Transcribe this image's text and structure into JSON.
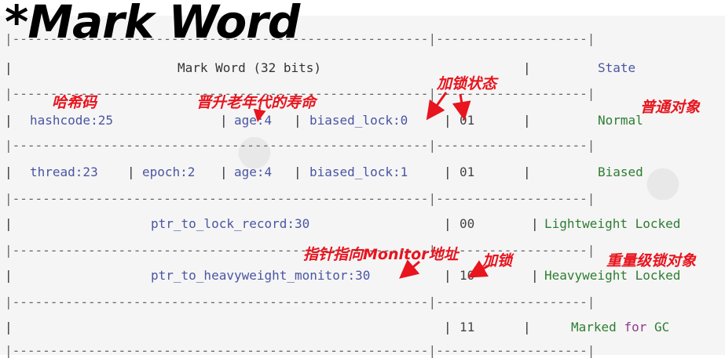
{
  "title": "*Mark Word",
  "table": {
    "header": {
      "left": "Mark Word (32 bits)",
      "right": "State"
    },
    "rows": [
      {
        "name": "normal",
        "cells": [
          "hashcode:25",
          "age:4",
          "biased_lock:0",
          "01"
        ],
        "state": "Normal"
      },
      {
        "name": "biased",
        "cells": [
          "thread:23",
          "epoch:2",
          "age:4",
          "biased_lock:1",
          "01"
        ],
        "state": "Biased"
      },
      {
        "name": "lightweight",
        "cells": [
          "ptr_to_lock_record:30",
          "00"
        ],
        "state": "Lightweight Locked"
      },
      {
        "name": "heavyweight",
        "cells": [
          "ptr_to_heavyweight_monitor:30",
          "10"
        ],
        "state": "Heavyweight Locked"
      },
      {
        "name": "gc",
        "cells": [
          "11"
        ],
        "state_parts": [
          "Marked",
          "for",
          "GC"
        ]
      }
    ]
  },
  "annotations": {
    "hashcode": "哈希码",
    "age": "晋升老年代的寿命",
    "lock_state": "加锁状态",
    "normal_object": "普通对象",
    "monitor_addr": "指针指向Monitor地址",
    "locked": "加锁",
    "heavy_object": "重量级锁对象"
  },
  "colors": {
    "annotation": "#e8141e",
    "identifier": "#4a55a2",
    "state": "#2e7d32"
  }
}
